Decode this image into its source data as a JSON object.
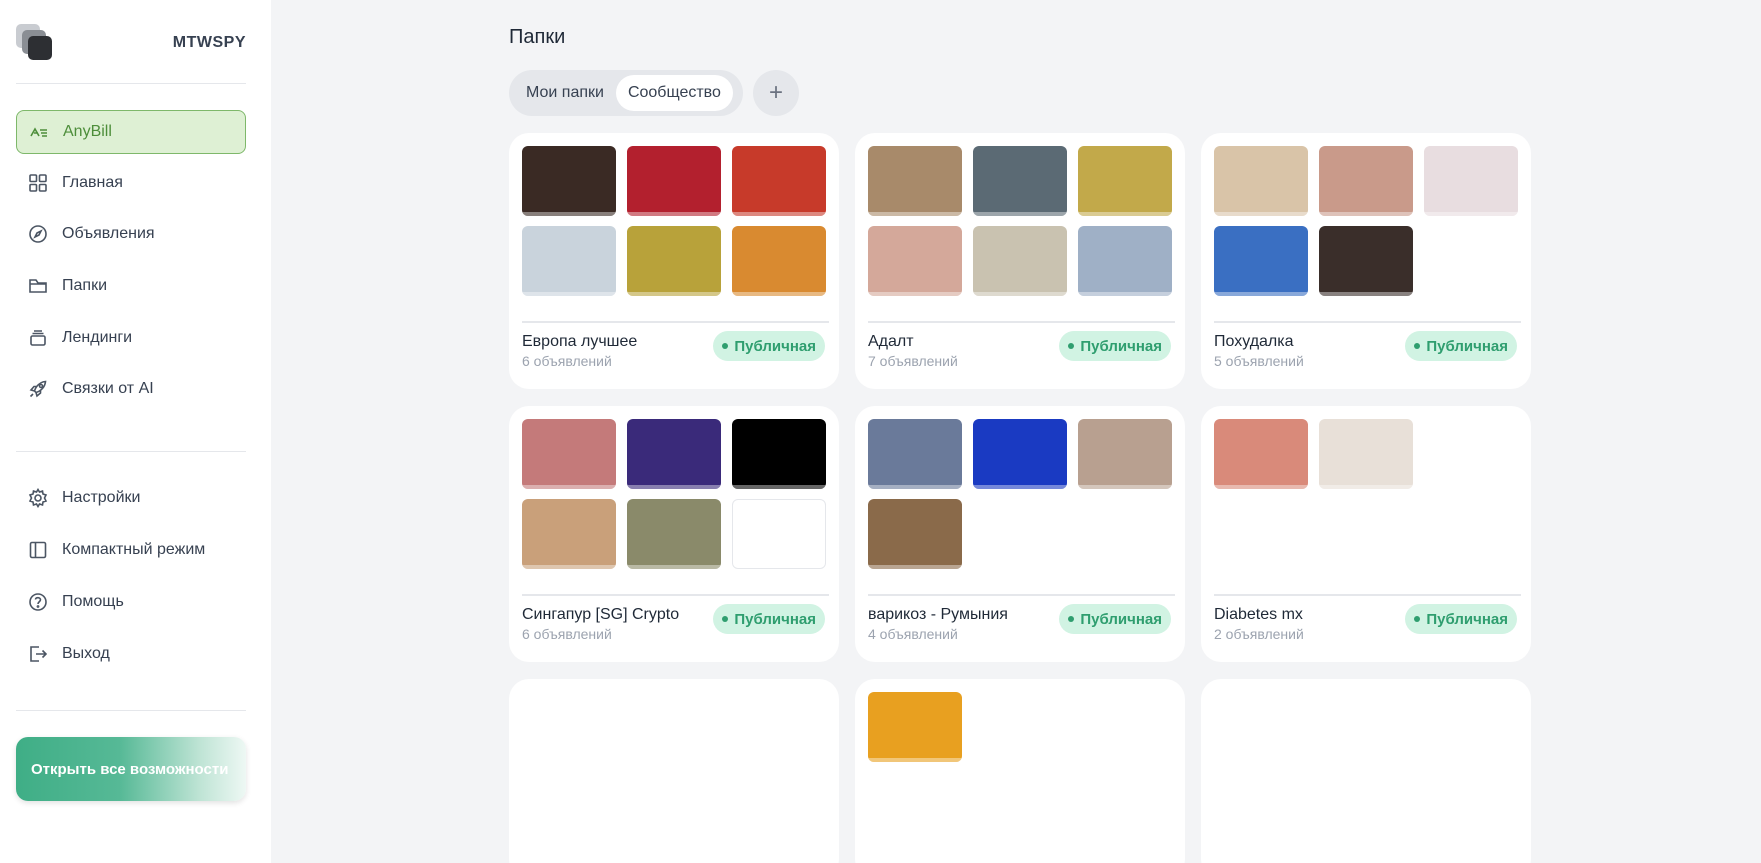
{
  "brand": {
    "name": "MTWSPY"
  },
  "sidebar": {
    "items": [
      {
        "label": "AnyBill",
        "icon": "anybill-icon",
        "active": true
      },
      {
        "label": "Главная",
        "icon": "grid-icon"
      },
      {
        "label": "Объявления",
        "icon": "compass-icon"
      },
      {
        "label": "Папки",
        "icon": "folder-icon"
      },
      {
        "label": "Лендинги",
        "icon": "stack-icon"
      },
      {
        "label": "Связки от AI",
        "icon": "rocket-icon"
      }
    ],
    "bottom_items": [
      {
        "label": "Настройки",
        "icon": "gear-icon"
      },
      {
        "label": "Компактный режим",
        "icon": "sidebar-icon"
      },
      {
        "label": "Помощь",
        "icon": "help-icon"
      },
      {
        "label": "Выход",
        "icon": "logout-icon"
      }
    ],
    "cta_label": "Открыть все возможности"
  },
  "main": {
    "title": "Папки",
    "tabs": [
      {
        "label": "Мои папки",
        "active": false
      },
      {
        "label": "Сообщество",
        "active": true
      }
    ],
    "add_label": "+",
    "folders": [
      {
        "name": "Европа лучшее",
        "count": "6 объявлений",
        "badge": "Публичная",
        "thumbs": [
          "#3a2a24",
          "#b3202e",
          "#c73a2a",
          "#c9d3dc",
          "#b8a23a",
          "#d98a30"
        ]
      },
      {
        "name": "Адалт",
        "count": "7 объявлений",
        "badge": "Публичная",
        "thumbs": [
          "#a88a6a",
          "#5b6a74",
          "#c2a94a",
          "#d4a89a",
          "#c9c2b0",
          "#9fb0c6",
          "#ffffff"
        ]
      },
      {
        "name": "Похудалка",
        "count": "5 объявлений",
        "badge": "Публичная",
        "thumbs": [
          "#d9c4a8",
          "#c99a8a",
          "#e8dde0",
          "#3a6fc2",
          "#3a2e2a"
        ]
      },
      {
        "name": "Сингапур [SG] Crypto",
        "count": "6 объявлений",
        "badge": "Публичная",
        "thumbs": [
          "#c47a7a",
          "#3a2a7a",
          "#000000",
          "#c9a07a",
          "#8a8a6a",
          "#ffffff"
        ]
      },
      {
        "name": "варикоз - Румыния",
        "count": "4 объявлений",
        "badge": "Публичная",
        "thumbs": [
          "#6a7a9a",
          "#1a3ac2",
          "#b8a090",
          "#8a6a4a"
        ]
      },
      {
        "name": "Diabetes mx",
        "count": "2 объявлений",
        "badge": "Публичная",
        "thumbs": [
          "#d98a7a",
          "#e8e0d8"
        ]
      },
      {
        "name": "",
        "count": "",
        "badge": "",
        "thumbs": []
      },
      {
        "name": "",
        "count": "",
        "badge": "",
        "thumbs": [
          "#e8a020"
        ]
      },
      {
        "name": "",
        "count": "",
        "badge": "",
        "thumbs": []
      }
    ]
  }
}
